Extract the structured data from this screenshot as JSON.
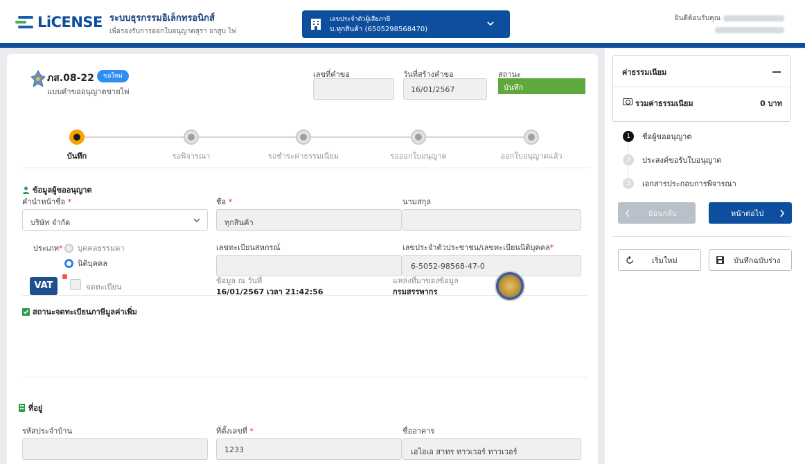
{
  "header": {
    "logo_text": "LiCENSE",
    "system_title": "ระบบธุรกรรมอิเล็กทรอนิกส์",
    "system_subtitle": "เพื่อรองรับการออกใบอนุญาตสุรา ยาสูบ ไพ่",
    "taxpayer_label": "เลขประจำตัวผู้เสียภาษี",
    "taxpayer_value": "บ.ทุกสินค้า (6505298568470)",
    "welcome_label": "ยินดีต้อนรับคุณ"
  },
  "form": {
    "code": "ภส.08-22",
    "badge": "ขอใหม่",
    "description": "แบบคำขออนุญาตขายไพ่",
    "request_no_label": "เลขที่คำขอ",
    "request_no_value": "",
    "created_label": "วันที่สร้างคำขอ",
    "created_value": "16/01/2567",
    "status_label": "สถานะ",
    "status_value": "บันทึก"
  },
  "stepper": [
    {
      "label": "บันทึก",
      "active": true
    },
    {
      "label": "รอพิจารณา",
      "active": false
    },
    {
      "label": "รอชำระค่าธรรมเนียม",
      "active": false
    },
    {
      "label": "รอออกใบอนุญาต",
      "active": false
    },
    {
      "label": "ออกใบอนุญาตแล้ว",
      "active": false
    }
  ],
  "applicant": {
    "section_title": "ข้อมูลผู้ขออนุญาต",
    "prefix_label": "คำนำหน้าชื่อ",
    "prefix_value": "บริษัท จำกัด",
    "name_label": "ชื่อ",
    "name_value": "ทุกสินค้า",
    "surname_label": "นามสกุล",
    "surname_value": "",
    "type_label": "ประเภท",
    "type_option_1": "บุคคลธรรมดา",
    "type_option_2": "นิติบุคคล",
    "coop_label": "เลขทะเบียนสหกรณ์",
    "coop_value": "",
    "id_label": "เลขประจำตัวประชาชน/เลขทะเบียนนิติบุคคล",
    "id_value": "6-5052-98568-47-0"
  },
  "vat": {
    "section_title": "สถานะจดทะเบียนภาษีมูลค่าเพิ่ม",
    "logo": "VAT",
    "checkbox_label": "จดทะเบียน",
    "as_of_label": "ข้อมูล ณ วันที่",
    "as_of_value": "16/01/2567 เวลา 21:42:56",
    "source_label": "แหล่งที่มาของข้อมูล",
    "source_value": "กรมสรรพากร"
  },
  "address": {
    "section_title": "ที่อยู่",
    "house_code_label": "รหัสประจำบ้าน",
    "house_code_value": "",
    "house_no_label": "ที่ตั้งเลขที่",
    "house_no_value": "1233",
    "building_label": "ชื่ออาคาร",
    "building_value": "เอไอเอ สาทร ทาวเวอร์ ทาวเวอร์"
  },
  "side": {
    "fee_title": "ค่าธรรมเนียม",
    "fee_sum_label": "รวมค่าธรรมเนียม",
    "fee_sum_value": "0 บาท",
    "steps": [
      {
        "num": "1",
        "label": "ชื่อผู้ขออนุญาต"
      },
      {
        "num": "2",
        "label": "ประสงค์ขอรับใบอนุญาต"
      },
      {
        "num": "3",
        "label": "เอกสารประกอบการพิจารณา"
      }
    ],
    "back_label": "ย้อนกลับ",
    "next_label": "หน้าต่อไป",
    "reset_label": "เริ่มใหม่",
    "save_draft_label": "บันทึกฉบับร่าง"
  },
  "colors": {
    "brand": "#0d4f9e",
    "status_green": "#5fa83c",
    "active_step": "#f7a300",
    "badge_blue": "#2f8ef2"
  }
}
